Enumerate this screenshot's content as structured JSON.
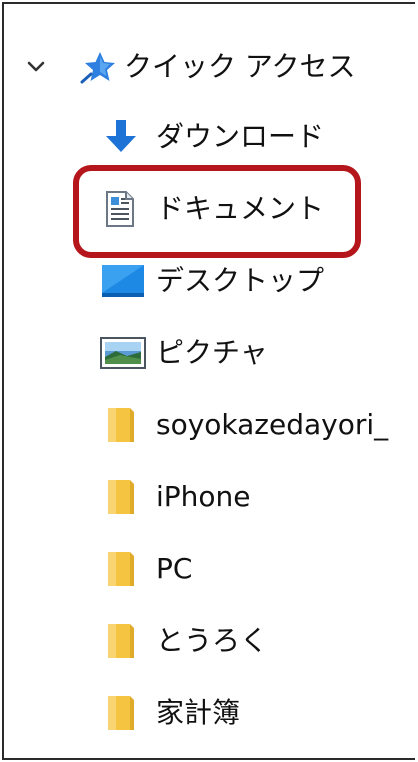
{
  "nav_pane": {
    "quick_access": {
      "label": "クイック アクセス",
      "expanded": true,
      "icon": "star-pin-icon"
    },
    "items": [
      {
        "label": "ダウンロード",
        "icon": "download-arrow-icon"
      },
      {
        "label": "ドキュメント",
        "icon": "document-icon",
        "highlighted": true
      },
      {
        "label": "デスクトップ",
        "icon": "desktop-icon"
      },
      {
        "label": "ピクチャ",
        "icon": "pictures-icon"
      },
      {
        "label": "soyokazedayori_",
        "icon": "folder-icon"
      },
      {
        "label": "iPhone",
        "icon": "folder-icon"
      },
      {
        "label": "PC",
        "icon": "folder-icon"
      },
      {
        "label": "とうろく",
        "icon": "folder-icon"
      },
      {
        "label": "家計簿",
        "icon": "folder-icon"
      }
    ]
  },
  "colors": {
    "highlight_border": "#b5161c",
    "folder": "#f5c542",
    "accent_blue": "#1e74d6"
  }
}
